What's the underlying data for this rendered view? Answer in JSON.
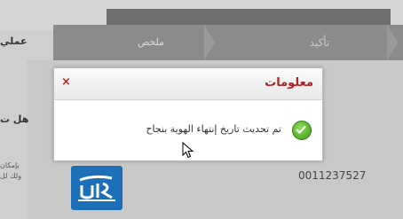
{
  "header": {
    "steps": [
      {
        "label": "ملخص"
      },
      {
        "label": "تأكيد"
      }
    ]
  },
  "sidebar": {
    "line1": "عملي",
    "line2": "هل ت",
    "line3": "بإمكان",
    "line4": "ولك لل"
  },
  "main": {
    "reference_number": "0011237527"
  },
  "dialog": {
    "title": "معلومات",
    "close_glyph": "×",
    "message": "تم تحديث تاريخ إنتهاء الهوية بنجاح",
    "status_icon": "success-check-icon"
  },
  "colors": {
    "dialog_title": "#b22222",
    "close": "#cc2222",
    "success": "#3c9a1a",
    "logo": "#1d6fb8"
  }
}
